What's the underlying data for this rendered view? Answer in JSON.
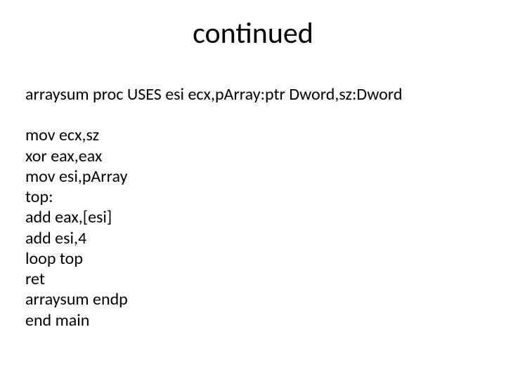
{
  "title": "continued",
  "proc_decl": "arraysum proc USES esi ecx,pArray:ptr Dword,sz:Dword",
  "lines": {
    "l1": "mov ecx,sz",
    "l2": "xor eax,eax",
    "l3": "mov esi,pArray",
    "l4": "top:",
    "l5": "add eax,[esi]",
    "l6": "add esi,4",
    "l7": "loop top",
    "l8": "ret",
    "l9": "arraysum endp",
    "l10": "end main"
  }
}
